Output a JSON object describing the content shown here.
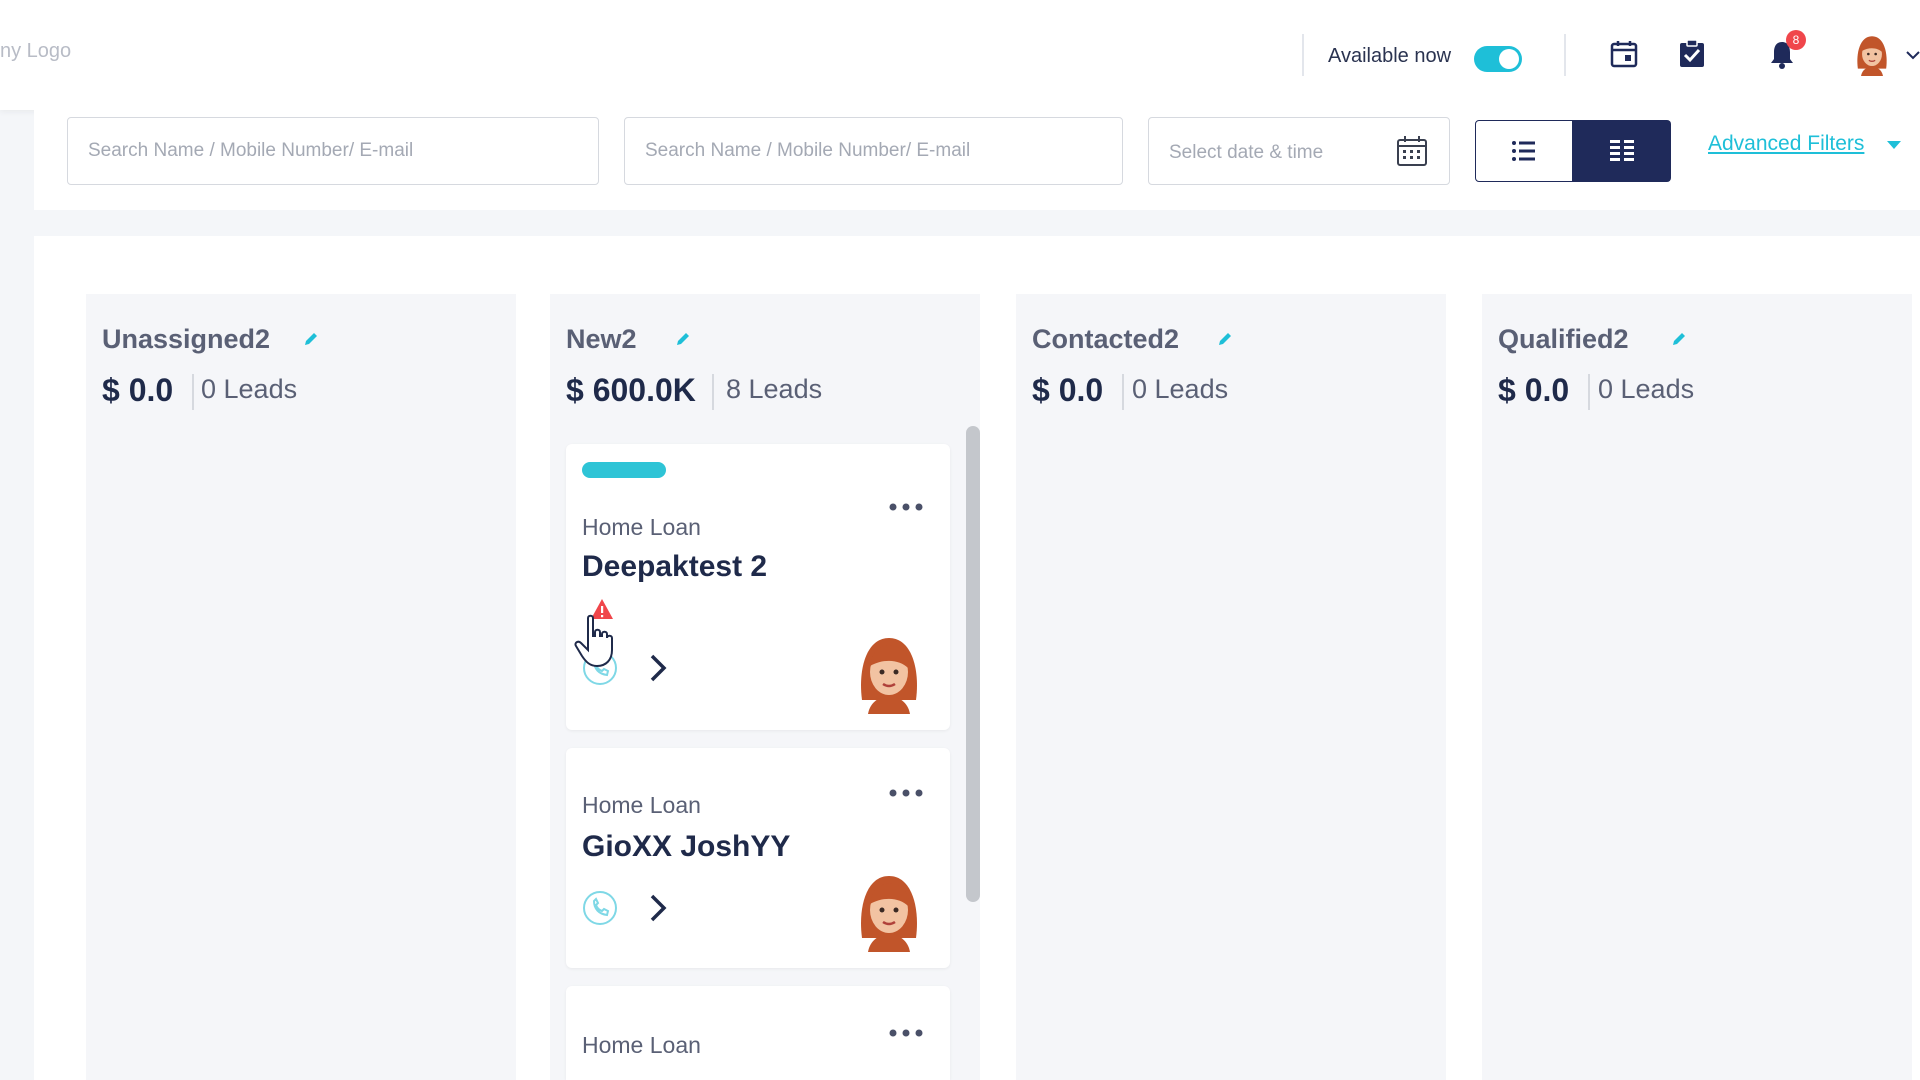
{
  "header": {
    "logo_text": "ny Logo",
    "availability_label": "Available now",
    "availability_on": true,
    "notification_count": "8",
    "icons": [
      "calendar-icon",
      "task-check-icon",
      "bell-icon",
      "user-avatar",
      "chevron-down-icon"
    ]
  },
  "filters": {
    "search1_placeholder": "Search Name / Mobile Number/ E-mail",
    "search2_placeholder": "Search Name / Mobile Number/ E-mail",
    "date_placeholder": "Select date & time",
    "view_modes": [
      "list",
      "board"
    ],
    "active_view": "board",
    "advanced_filters_label": "Advanced Filters"
  },
  "columns": [
    {
      "title": "Unassigned2",
      "amount": "$ 0.0",
      "leads": "0 Leads"
    },
    {
      "title": "New2",
      "amount": "$ 600.0K",
      "leads": "8 Leads"
    },
    {
      "title": "Contacted2",
      "amount": "$ 0.0",
      "leads": "0 Leads"
    },
    {
      "title": "Qualified2",
      "amount": "$ 0.0",
      "leads": "0 Leads"
    }
  ],
  "cards": [
    {
      "product": "Home Loan",
      "name": "Deepaktest 2",
      "tag_color": "#2ec4d6"
    },
    {
      "product": "Home Loan",
      "name": "GioXX JoshYY"
    },
    {
      "product": "Home Loan",
      "name": ""
    }
  ],
  "colors": {
    "accent": "#1ebfd8",
    "navy": "#1f2a5a",
    "badge": "#f0464b"
  }
}
